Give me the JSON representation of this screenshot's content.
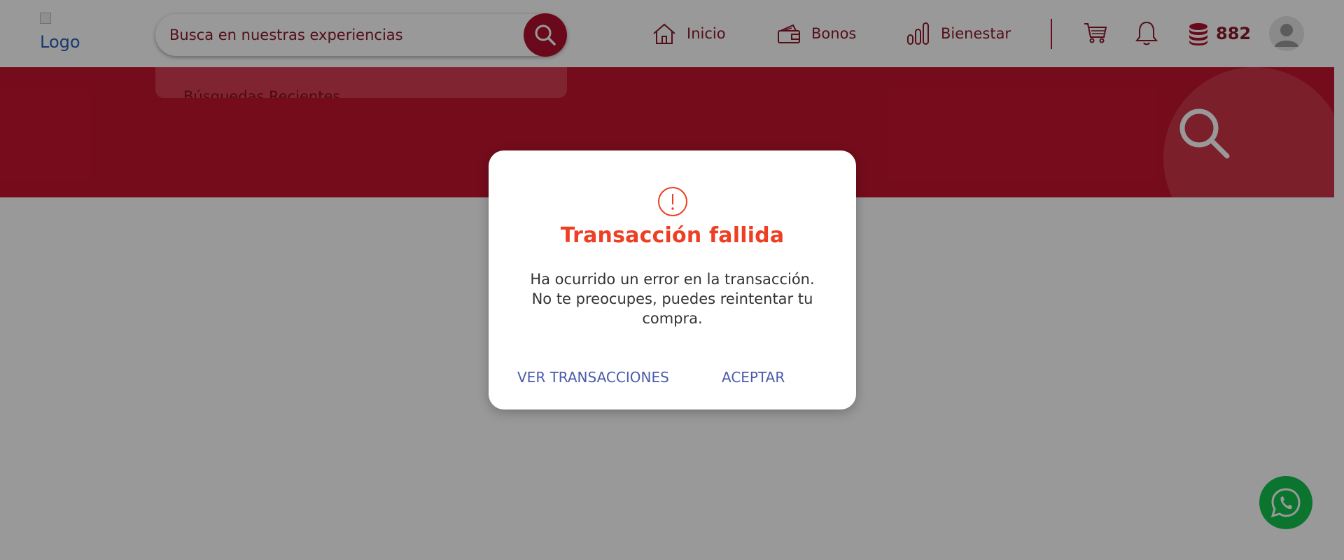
{
  "header": {
    "logo_alt": "Logo",
    "search": {
      "placeholder": "Busca en nuestras experiencias",
      "value": ""
    },
    "nav": [
      {
        "label": "Inicio",
        "icon": "home-icon"
      },
      {
        "label": "Bonos",
        "icon": "wallet-icon"
      },
      {
        "label": "Bienestar",
        "icon": "bar-chart-icon"
      }
    ],
    "points": "882"
  },
  "search_dropdown": {
    "label": "Búsquedas Recientes"
  },
  "modal": {
    "icon": "exclamation-circle-icon",
    "title": "Transacción fallida",
    "message": "Ha ocurrido un error en la transacción. No te preocupes, puedes reintentar tu compra.",
    "secondary_button": "VER TRANSACCIONES",
    "primary_button": "ACEPTAR"
  },
  "colors": {
    "brand": "#b0102e",
    "error": "#ee3f24",
    "link": "#4a5bab",
    "whatsapp": "#13c24e"
  }
}
